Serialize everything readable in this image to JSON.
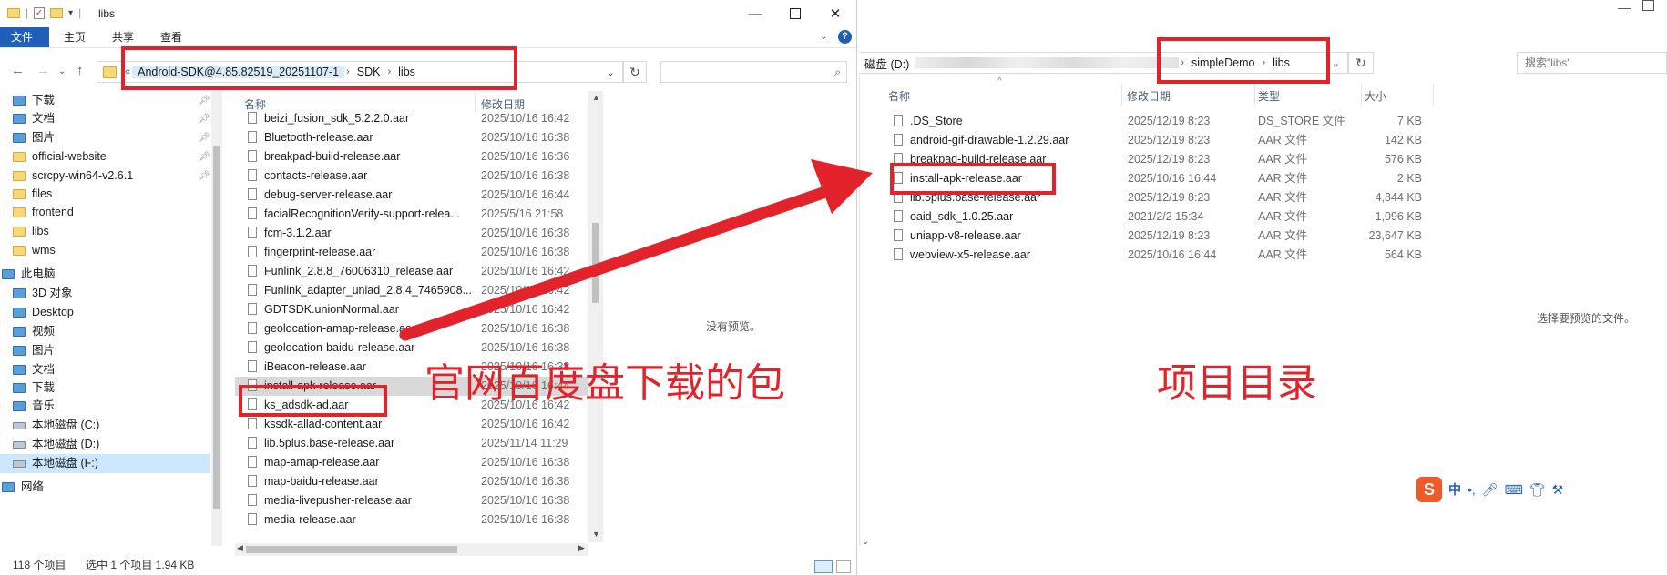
{
  "left": {
    "window_title": "libs",
    "ribbon_tabs": [
      "文件",
      "主页",
      "共享",
      "查看"
    ],
    "breadcrumb": [
      "Android-SDK@4.85.82519_20251107-1",
      "SDK",
      "libs"
    ],
    "nav_items": [
      {
        "label": "下载",
        "icon": "download-icon",
        "pinned": true
      },
      {
        "label": "文档",
        "icon": "document-icon",
        "pinned": true
      },
      {
        "label": "图片",
        "icon": "pictures-icon",
        "pinned": true
      },
      {
        "label": "official-website",
        "icon": "folder-icon",
        "pinned": true
      },
      {
        "label": "scrcpy-win64-v2.6.1",
        "icon": "folder-icon",
        "pinned": true
      },
      {
        "label": "files",
        "icon": "folder-icon"
      },
      {
        "label": "frontend",
        "icon": "folder-icon"
      },
      {
        "label": "libs",
        "icon": "folder-icon"
      },
      {
        "label": "wms",
        "icon": "folder-icon"
      },
      {
        "label": "此电脑",
        "icon": "computer-icon"
      },
      {
        "label": "3D 对象",
        "icon": "3d-objects-icon"
      },
      {
        "label": "Desktop",
        "icon": "desktop-icon"
      },
      {
        "label": "视频",
        "icon": "video-icon"
      },
      {
        "label": "图片",
        "icon": "pictures-icon"
      },
      {
        "label": "文档",
        "icon": "document-icon"
      },
      {
        "label": "下载",
        "icon": "download-icon"
      },
      {
        "label": "音乐",
        "icon": "music-icon"
      },
      {
        "label": "本地磁盘 (C:)",
        "icon": "drive-icon"
      },
      {
        "label": "本地磁盘 (D:)",
        "icon": "drive-icon"
      },
      {
        "label": "本地磁盘 (F:)",
        "icon": "drive-icon",
        "selected": true
      },
      {
        "label": "网络",
        "icon": "network-icon"
      }
    ],
    "columns": {
      "name": "名称",
      "date": "修改日期"
    },
    "files": [
      {
        "name": "beizi_fusion_sdk_5.2.2.0.aar",
        "date": "2025/10/16 16:42"
      },
      {
        "name": "Bluetooth-release.aar",
        "date": "2025/10/16 16:38"
      },
      {
        "name": "breakpad-build-release.aar",
        "date": "2025/10/16 16:36"
      },
      {
        "name": "contacts-release.aar",
        "date": "2025/10/16 16:38"
      },
      {
        "name": "debug-server-release.aar",
        "date": "2025/10/16 16:44"
      },
      {
        "name": "facialRecognitionVerify-support-relea...",
        "date": "2025/5/16 21:58"
      },
      {
        "name": "fcm-3.1.2.aar",
        "date": "2025/10/16 16:38"
      },
      {
        "name": "fingerprint-release.aar",
        "date": "2025/10/16 16:38"
      },
      {
        "name": "Funlink_2.8.8_76006310_release.aar",
        "date": "2025/10/16 16:42"
      },
      {
        "name": "Funlink_adapter_uniad_2.8.4_7465908...",
        "date": "2025/10/16 16:42"
      },
      {
        "name": "GDTSDK.unionNormal.aar",
        "date": "2025/10/16 16:42"
      },
      {
        "name": "geolocation-amap-release.aar",
        "date": "2025/10/16 16:38"
      },
      {
        "name": "geolocation-baidu-release.aar",
        "date": "2025/10/16 16:38"
      },
      {
        "name": "iBeacon-release.aar",
        "date": "2025/10/16 16:38"
      },
      {
        "name": "install-apk-release.aar",
        "date": "2025/10/16 16:44",
        "selected": true
      },
      {
        "name": "ks_adsdk-ad.aar",
        "date": "2025/10/16 16:42"
      },
      {
        "name": "kssdk-allad-content.aar",
        "date": "2025/10/16 16:42"
      },
      {
        "name": "lib.5plus.base-release.aar",
        "date": "2025/11/14 11:29"
      },
      {
        "name": "map-amap-release.aar",
        "date": "2025/10/16 16:38"
      },
      {
        "name": "map-baidu-release.aar",
        "date": "2025/10/16 16:38"
      },
      {
        "name": "media-livepusher-release.aar",
        "date": "2025/10/16 16:38"
      },
      {
        "name": "media-release.aar",
        "date": "2025/10/16 16:38"
      }
    ],
    "preview_message": "没有预览。",
    "status_count": "118 个项目",
    "status_selection": "选中 1 个项目  1.94 KB",
    "annotation": "官网百度盘下载的包"
  },
  "right": {
    "breadcrumb_prefix": "磁盘 (D:)",
    "breadcrumb": [
      "simpleDemo",
      "libs"
    ],
    "search_placeholder": "搜索\"libs\"",
    "columns": {
      "name": "名称",
      "date": "修改日期",
      "type": "类型",
      "size": "大小"
    },
    "files": [
      {
        "name": ".DS_Store",
        "date": "2025/12/19 8:23",
        "type": "DS_STORE 文件",
        "size": "7 KB"
      },
      {
        "name": "android-gif-drawable-1.2.29.aar",
        "date": "2025/12/19 8:23",
        "type": "AAR 文件",
        "size": "142 KB"
      },
      {
        "name": "breakpad-build-release.aar",
        "date": "2025/12/19 8:23",
        "type": "AAR 文件",
        "size": "576 KB"
      },
      {
        "name": "install-apk-release.aar",
        "date": "2025/10/16 16:44",
        "type": "AAR 文件",
        "size": "2 KB"
      },
      {
        "name": "lib.5plus.base-release.aar",
        "date": "2025/12/19 8:23",
        "type": "AAR 文件",
        "size": "4,844 KB"
      },
      {
        "name": "oaid_sdk_1.0.25.aar",
        "date": "2021/2/2 15:34",
        "type": "AAR 文件",
        "size": "1,096 KB"
      },
      {
        "name": "uniapp-v8-release.aar",
        "date": "2025/12/19 8:23",
        "type": "AAR 文件",
        "size": "23,647 KB"
      },
      {
        "name": "webview-x5-release.aar",
        "date": "2025/10/16 16:44",
        "type": "AAR 文件",
        "size": "564 KB"
      }
    ],
    "preview_message": "选择要预览的文件。",
    "annotation": "项目目录"
  },
  "ime": {
    "logo": "S",
    "lang": "中"
  },
  "colors": {
    "annotation_red": "#e3232b",
    "accent_blue": "#1f5fb7",
    "selection": "#cce8ff"
  }
}
